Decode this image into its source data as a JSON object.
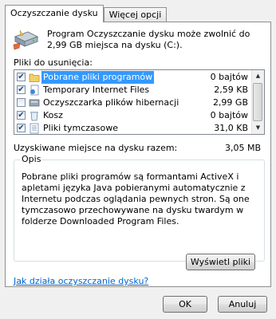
{
  "tabs": [
    {
      "label": "Oczyszczanie dysku",
      "active": true
    },
    {
      "label": "Więcej opcji",
      "active": false
    }
  ],
  "intro": {
    "icon": "disk-cleanup-icon",
    "text": "Program Oczyszczanie dysku może zwolnić do 2,99 GB miejsca na dysku  (C:)."
  },
  "files_label": "Pliki do usunięcia:",
  "files": [
    {
      "checked": true,
      "icon": "folder-icon",
      "name": "Pobrane pliki programów",
      "size": "0 bajtów",
      "selected": true
    },
    {
      "checked": true,
      "icon": "document-icon",
      "name": "Temporary Internet Files",
      "size": "2,59 KB",
      "selected": false
    },
    {
      "checked": false,
      "icon": "hibernation-icon",
      "name": "Oczyszczarka plików hibernacji",
      "size": "2,99 GB",
      "selected": false
    },
    {
      "checked": true,
      "icon": "recycle-bin-icon",
      "name": "Kosz",
      "size": "0 bajtów",
      "selected": false
    },
    {
      "checked": true,
      "icon": "temp-files-icon",
      "name": "Pliki tymczasowe",
      "size": "31,0 KB",
      "selected": false
    }
  ],
  "space_gain": {
    "label": "Uzyskiwane miejsce na dysku razem:",
    "value": "3,05 MB"
  },
  "description": {
    "title": "Opis",
    "text": "Pobrane pliki programów są formantami ActiveX i apletami języka Java pobieranymi automatycznie z Internetu podczas oglądania pewnych stron. Są one tymczasowo przechowywane na dysku twardym w folderze Downloaded Program Files.",
    "button": "Wyświetl pliki"
  },
  "help_link": "Jak działa oczyszczanie dysku?",
  "buttons": {
    "ok": "OK",
    "cancel": "Anuluj"
  },
  "colors": {
    "selection": "#3399ff",
    "link": "#0066cc"
  }
}
